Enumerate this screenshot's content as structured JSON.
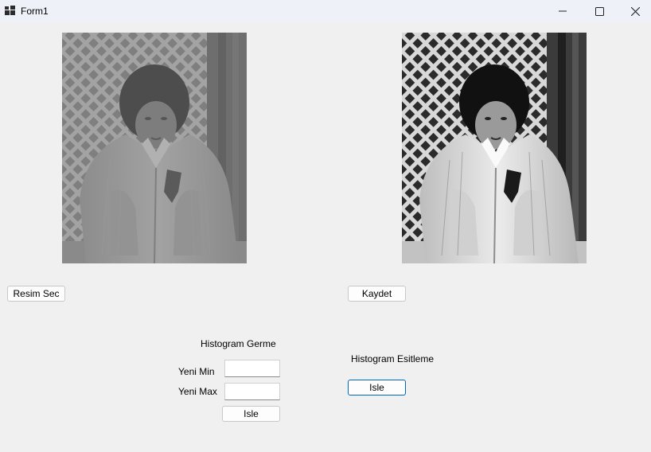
{
  "window": {
    "title": "Form1"
  },
  "icons": {
    "app": "app-icon",
    "minimize": "minimize-icon",
    "maximize": "maximize-icon",
    "close": "close-icon"
  },
  "images": {
    "original": "original-photo (low-contrast grayscale child in jacket)",
    "processed": "processed-photo (contrast-enhanced grayscale child in jacket)"
  },
  "buttons": {
    "select_image": "Resim Sec",
    "save": "Kaydet",
    "stretch_process": "Isle",
    "equalize_process": "Isle"
  },
  "stretch": {
    "heading": "Histogram Germe",
    "new_min_label": "Yeni Min",
    "new_min_value": "",
    "new_max_label": "Yeni Max",
    "new_max_value": ""
  },
  "equalize": {
    "heading": "Histogram Esitleme"
  }
}
